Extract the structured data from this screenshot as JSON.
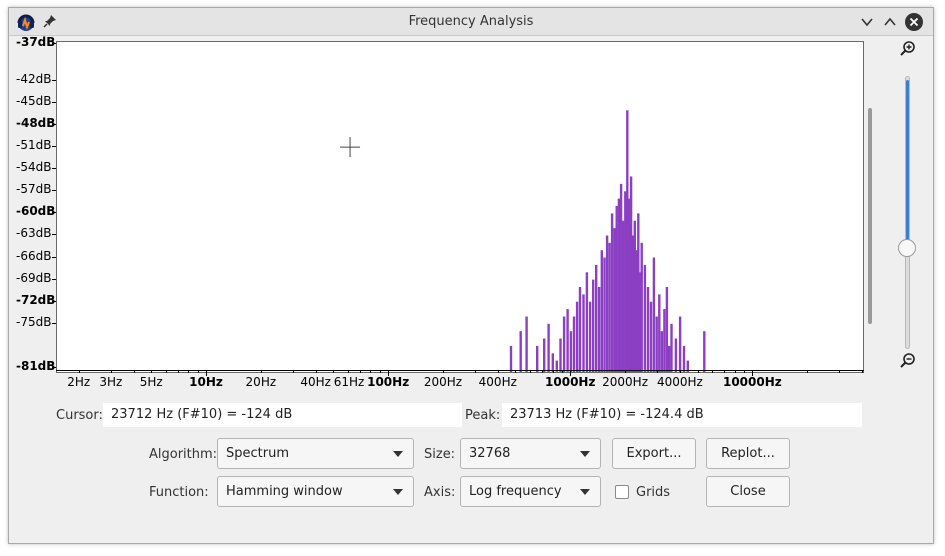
{
  "window": {
    "title": "Frequency Analysis"
  },
  "titlebar_icons": {
    "app": "audacity-icon",
    "pin": "pin-icon",
    "minimize": "chevron-down-icon",
    "maximize": "chevron-up-icon",
    "close": "close-icon"
  },
  "colors": {
    "spectrum": "#8b3fc2",
    "accent": "#3d7fcf"
  },
  "chart_data": {
    "type": "bar",
    "xscale": "log",
    "xlim": [
      1.5,
      40000
    ],
    "ylim": [
      -81,
      -37
    ],
    "y_ticks": [
      {
        "label": "-37dB",
        "value": -37,
        "bold": true
      },
      {
        "label": "-42dB",
        "value": -42,
        "bold": false
      },
      {
        "label": "-45dB",
        "value": -45,
        "bold": false
      },
      {
        "label": "-48dB",
        "value": -48,
        "bold": true
      },
      {
        "label": "-51dB",
        "value": -51,
        "bold": false
      },
      {
        "label": "-54dB",
        "value": -54,
        "bold": false
      },
      {
        "label": "-57dB",
        "value": -57,
        "bold": false
      },
      {
        "label": "-60dB",
        "value": -60,
        "bold": true
      },
      {
        "label": "-63dB",
        "value": -63,
        "bold": false
      },
      {
        "label": "-66dB",
        "value": -66,
        "bold": false
      },
      {
        "label": "-69dB",
        "value": -69,
        "bold": false
      },
      {
        "label": "-72dB",
        "value": -72,
        "bold": true
      },
      {
        "label": "-75dB",
        "value": -75,
        "bold": false
      },
      {
        "label": "-81dB",
        "value": -81,
        "bold": true
      }
    ],
    "x_ticks": [
      {
        "label": "2Hz",
        "value": 2,
        "bold": false
      },
      {
        "label": "3Hz",
        "value": 3,
        "bold": false
      },
      {
        "label": "5Hz",
        "value": 5,
        "bold": false
      },
      {
        "label": "10Hz",
        "value": 10,
        "bold": true
      },
      {
        "label": "20Hz",
        "value": 20,
        "bold": false
      },
      {
        "label": "40Hz",
        "value": 40,
        "bold": false
      },
      {
        "label": "61Hz",
        "value": 61,
        "bold": false
      },
      {
        "label": "100Hz",
        "value": 100,
        "bold": true
      },
      {
        "label": "200Hz",
        "value": 200,
        "bold": false
      },
      {
        "label": "400Hz",
        "value": 400,
        "bold": false
      },
      {
        "label": "1000Hz",
        "value": 1000,
        "bold": true
      },
      {
        "label": "2000Hz",
        "value": 2000,
        "bold": false
      },
      {
        "label": "4000Hz",
        "value": 4000,
        "bold": false
      },
      {
        "label": "10000Hz",
        "value": 10000,
        "bold": true
      }
    ],
    "series": [
      {
        "x": [
          460,
          520,
          560,
          640,
          700,
          740,
          780,
          820,
          860,
          900,
          940,
          980,
          1020,
          1060,
          1100,
          1150,
          1200,
          1250,
          1300,
          1350,
          1400,
          1450,
          1500,
          1550,
          1600,
          1650,
          1700,
          1750,
          1800,
          1850,
          1900,
          1950,
          2000,
          2050,
          2100,
          2150,
          2200,
          2250,
          2300,
          2350,
          2400,
          2500,
          2600,
          2700,
          2800,
          2900,
          3000,
          3100,
          3200,
          3300,
          3400,
          3500,
          3700,
          3900,
          4100,
          4300,
          5300
        ],
        "y": [
          -78,
          -76,
          -74,
          -78,
          -77,
          -75,
          -79,
          -80,
          -77,
          -74,
          -73,
          -76,
          -74,
          -72,
          -70,
          -71,
          -68,
          -72,
          -69,
          -67,
          -70,
          -65,
          -66,
          -63,
          -64,
          -60,
          -62,
          -59,
          -58,
          -56,
          -61,
          -57,
          -46,
          -58,
          -55,
          -63,
          -61,
          -65,
          -60,
          -68,
          -64,
          -67,
          -70,
          -72,
          -66,
          -74,
          -71,
          -76,
          -73,
          -70,
          -78,
          -75,
          -77,
          -74,
          -78,
          -80,
          -76
        ]
      }
    ]
  },
  "cursor_mark": {
    "freq": 61,
    "db": -51
  },
  "readouts": {
    "cursor_label": "Cursor:",
    "cursor_value": "23712 Hz (F#10) = -124 dB",
    "peak_label": "Peak:",
    "peak_value": "23713 Hz (F#10) = -124.4 dB"
  },
  "controls": {
    "algorithm_label": "Algorithm:",
    "algorithm_value": "Spectrum",
    "size_label": "Size:",
    "size_value": "32768",
    "function_label": "Function:",
    "function_value": "Hamming window",
    "axis_label": "Axis:",
    "axis_value": "Log frequency",
    "grids_label": "Grids",
    "grids_checked": false
  },
  "buttons": {
    "export": "Export...",
    "replot": "Replot...",
    "close": "Close"
  },
  "zoom": {
    "in_icon": "zoom-in-icon",
    "out_icon": "zoom-out-icon",
    "level": 0.38
  }
}
